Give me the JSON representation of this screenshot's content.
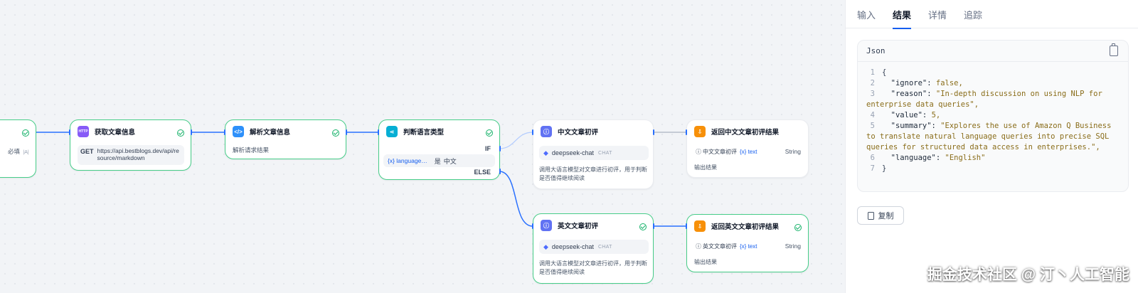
{
  "colors": {
    "accent": "#155eef",
    "success": "#17b26a",
    "edge": "#2970ff",
    "http_icon": "#875bf7",
    "code_icon": "#2e90fa",
    "if_icon": "#06aed4",
    "llm_icon": "#6172f3",
    "answer_icon": "#f79009"
  },
  "nodes": {
    "start": {
      "field_label": "必填",
      "field_tag": "|A|"
    },
    "http": {
      "title": "获取文章信息",
      "icon": "http-icon",
      "method": "GET",
      "url": "https://api.bestblogs.dev/api/resource/markdown"
    },
    "parse": {
      "title": "解析文章信息",
      "icon": "code-icon",
      "desc": "解析请求结果"
    },
    "branch": {
      "title": "判断语言类型",
      "icon": "if-else-icon",
      "if_label": "IF",
      "var": "{x} language…",
      "op": "是",
      "value": "中文",
      "else_label": "ELSE"
    },
    "zh_review": {
      "title": "中文文章初评",
      "icon": "llm-icon",
      "model": "deepseek-chat",
      "mode": "CHAT",
      "desc": "调用大语言模型对文章进行初评，用于判断是否值得继续阅读"
    },
    "zh_answer": {
      "title": "返回中文文章初评结果",
      "icon": "answer-icon",
      "var_label": "中文文章初评",
      "var_name": "{x} text",
      "var_type": "String",
      "desc": "输出结果"
    },
    "en_review": {
      "title": "英文文章初评",
      "icon": "llm-icon",
      "model": "deepseek-chat",
      "mode": "CHAT",
      "desc": "调用大语言模型对文章进行初评，用于判断是否值得继续阅读"
    },
    "en_answer": {
      "title": "返回英文文章初评结果",
      "icon": "answer-icon",
      "var_label": "英文文章初评",
      "var_name": "{x} text",
      "var_type": "String",
      "desc": "输出结果"
    }
  },
  "panel": {
    "tabs": [
      "输入",
      "结果",
      "详情",
      "追踪"
    ],
    "active_tab": "结果",
    "json_title": "Json",
    "json_lines": [
      {
        "n": "1",
        "text": "{"
      },
      {
        "n": "2",
        "key": "\"ignore\"",
        "val": "false,"
      },
      {
        "n": "3",
        "key": "\"reason\"",
        "val": "\"In-depth discussion on using NLP for",
        "cont": "enterprise data queries\","
      },
      {
        "n": "4",
        "key": "\"value\"",
        "val": "5,"
      },
      {
        "n": "5",
        "key": "\"summary\"",
        "val": "\"Explores the use of Amazon Q Business",
        "cont": "to translate natural language queries into precise SQL queries for structured data access in enterprises.\","
      },
      {
        "n": "6",
        "key": "\"language\"",
        "val": "\"English\""
      },
      {
        "n": "7",
        "text": "}"
      }
    ],
    "copy_label": "复制"
  },
  "watermark": "掘金技术社区 @ 汀丶人工智能"
}
